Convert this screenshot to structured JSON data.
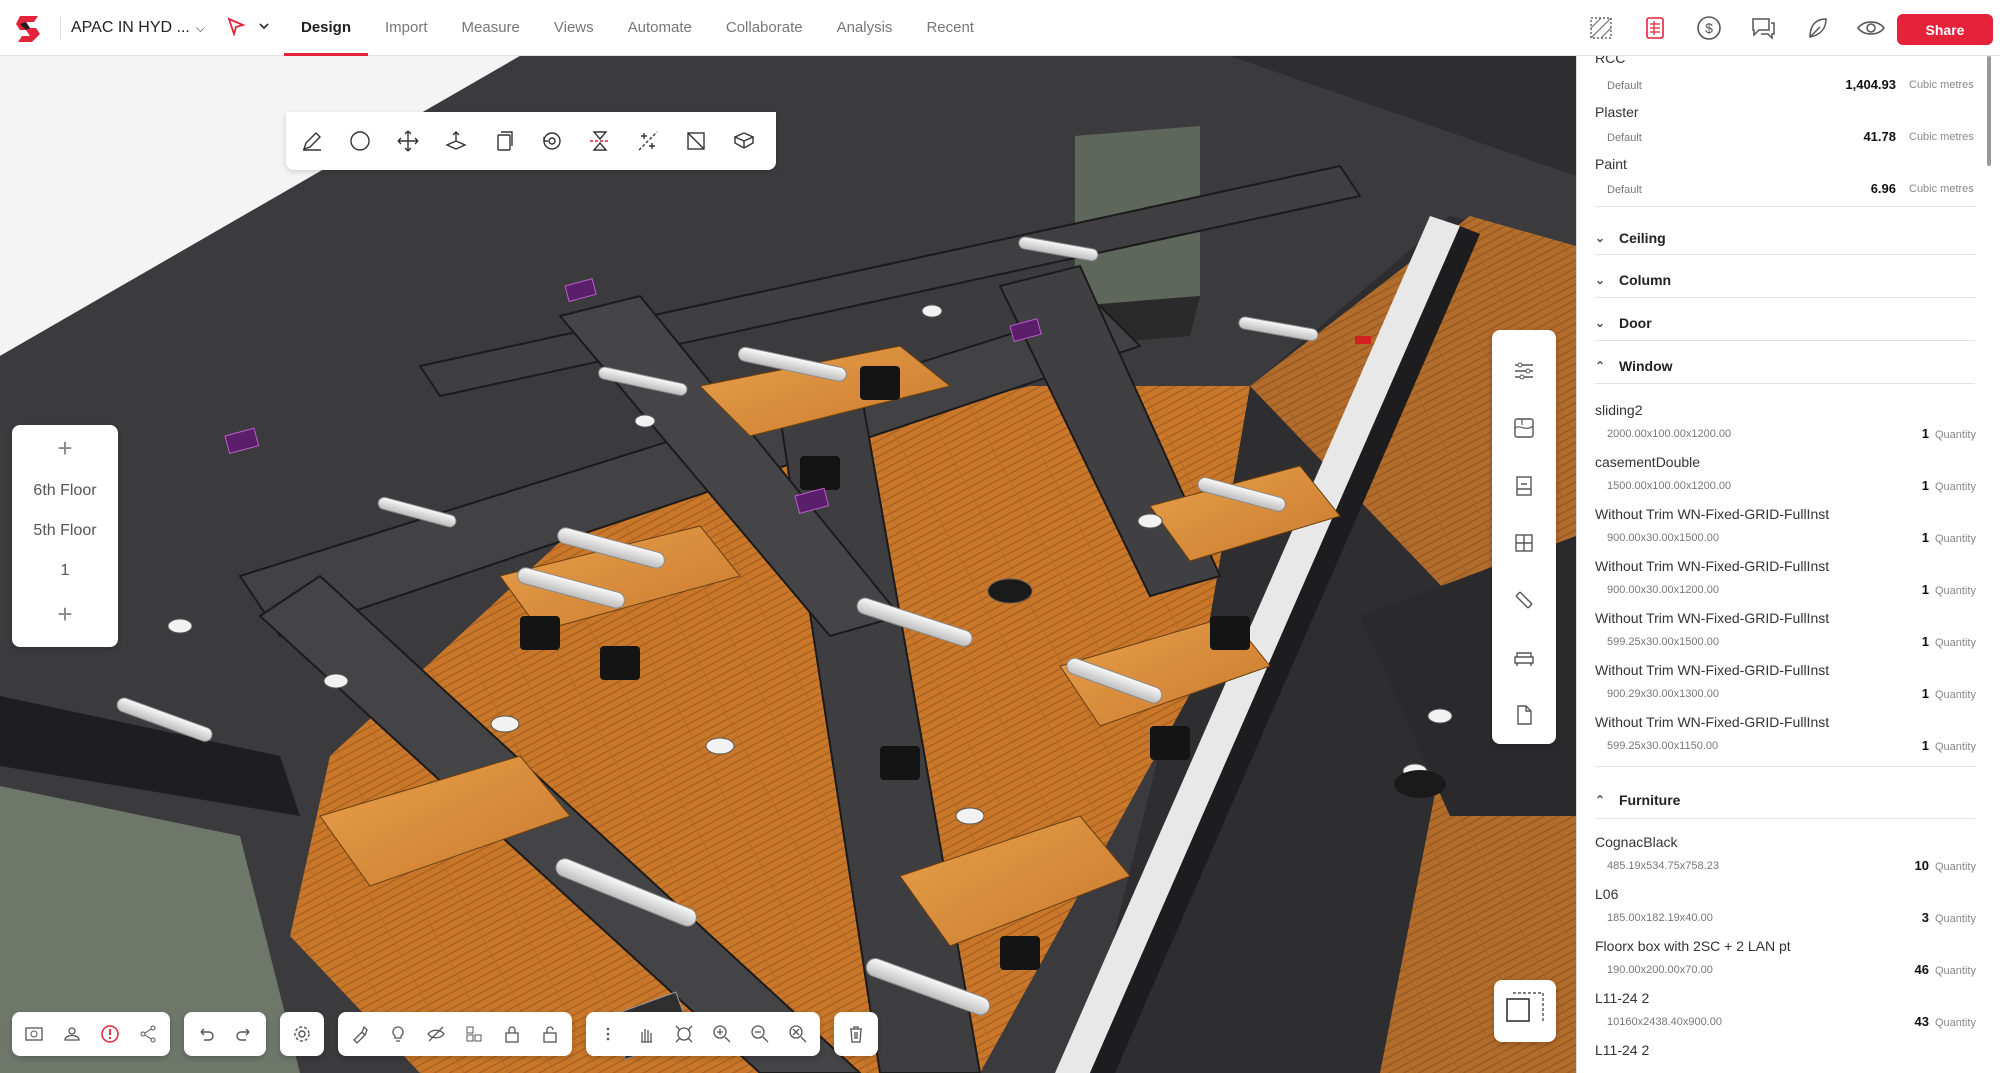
{
  "header": {
    "project_name": "APAC IN HYD ...",
    "tabs": [
      "Design",
      "Import",
      "Measure",
      "Views",
      "Automate",
      "Collaborate",
      "Analysis",
      "Recent"
    ],
    "active_tab": "Design",
    "share_label": "Share",
    "right_icons": [
      "hatch-icon",
      "report-icon",
      "dollar-icon",
      "comments-icon",
      "leaf-icon",
      "eye-icon"
    ]
  },
  "colors": {
    "accent": "#e4223a",
    "wood": "#d9872f",
    "dark": "#2e2e30",
    "duct": "#3a3a3c"
  },
  "floors": {
    "items": [
      "6th Floor",
      "5th Floor",
      "1"
    ]
  },
  "draw_tools": [
    "pencil-icon",
    "circle-icon",
    "move-icon",
    "extrude-icon",
    "copy-icon",
    "rotate-icon",
    "align-icon",
    "split-icon",
    "section-icon",
    "box-icon"
  ],
  "right_tools": [
    "sliders-icon",
    "map-icon",
    "elevator-icon",
    "grid-icon",
    "pipe-icon",
    "sofa-icon",
    "document-icon"
  ],
  "panel": {
    "materials": [
      {
        "name": "RCC",
        "sub": "Default",
        "value": "1,404.93",
        "unit": "Cubic metres"
      },
      {
        "name": "Plaster",
        "sub": "Default",
        "value": "41.78",
        "unit": "Cubic metres"
      },
      {
        "name": "Paint",
        "sub": "Default",
        "value": "6.96",
        "unit": "Cubic metres"
      }
    ],
    "collapsed_sections": [
      "Ceiling",
      "Column",
      "Door"
    ],
    "window_section": "Window",
    "windows": [
      {
        "name": "sliding2",
        "sub": "2000.00x100.00x1200.00",
        "value": "1",
        "unit": "Quantity"
      },
      {
        "name": "casementDouble",
        "sub": "1500.00x100.00x1200.00",
        "value": "1",
        "unit": "Quantity"
      },
      {
        "name": "Without Trim WN-Fixed-GRID-FullInst",
        "sub": "900.00x30.00x1500.00",
        "value": "1",
        "unit": "Quantity"
      },
      {
        "name": "Without Trim WN-Fixed-GRID-FullInst",
        "sub": "900.00x30.00x1200.00",
        "value": "1",
        "unit": "Quantity"
      },
      {
        "name": "Without Trim WN-Fixed-GRID-FullInst",
        "sub": "599.25x30.00x1500.00",
        "value": "1",
        "unit": "Quantity"
      },
      {
        "name": "Without Trim WN-Fixed-GRID-FullInst",
        "sub": "900.29x30.00x1300.00",
        "value": "1",
        "unit": "Quantity"
      },
      {
        "name": "Without Trim WN-Fixed-GRID-FullInst",
        "sub": "599.25x30.00x1150.00",
        "value": "1",
        "unit": "Quantity"
      }
    ],
    "furniture_section": "Furniture",
    "furniture": [
      {
        "name": "CognacBlack",
        "sub": "485.19x534.75x758.23",
        "value": "10",
        "unit": "Quantity"
      },
      {
        "name": "L06",
        "sub": "185.00x182.19x40.00",
        "value": "3",
        "unit": "Quantity"
      },
      {
        "name": "Floorx box with 2SC + 2 LAN pt",
        "sub": "190.00x200.00x70.00",
        "value": "46",
        "unit": "Quantity"
      },
      {
        "name": "L11-24 2",
        "sub": "10160x2438.40x900.00",
        "value": "43",
        "unit": "Quantity"
      },
      {
        "name": "L11-24 2",
        "sub": "",
        "value": "",
        "unit": ""
      }
    ]
  },
  "bottom_tools": {
    "group1": [
      "search-view-icon",
      "map-pin-icon",
      "info-icon",
      "share-node-icon"
    ],
    "group2": [
      "undo-icon",
      "redo-icon"
    ],
    "group3": [
      "settings-icon"
    ],
    "group4": [
      "paint-icon",
      "bulb-icon",
      "hide-icon",
      "components-icon",
      "lock-icon",
      "unlock-icon"
    ],
    "group5": [
      "more-icon",
      "hand-icon",
      "fit-icon",
      "zoom-in-icon",
      "zoom-out-icon",
      "zoom-extent-icon"
    ],
    "group6": [
      "trash-icon"
    ]
  }
}
